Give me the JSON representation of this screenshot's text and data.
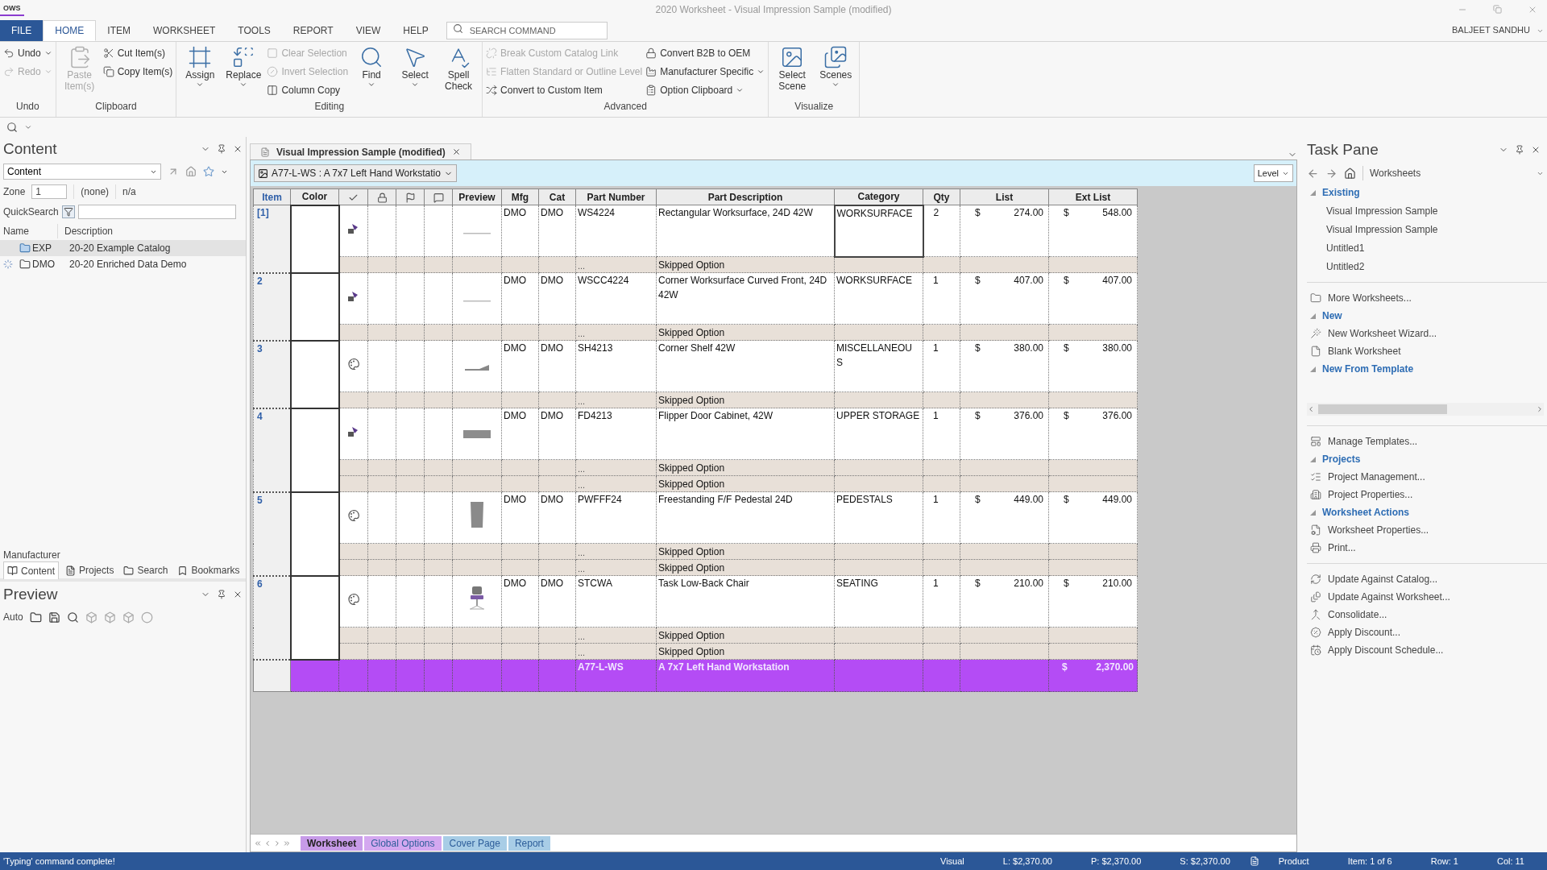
{
  "window": {
    "title": "2020 Worksheet - Visual Impression Sample (modified)",
    "logo": "OWS"
  },
  "ribbon_tabs": [
    {
      "label": "FILE",
      "kind": "file",
      "selected": false
    },
    {
      "label": "HOME",
      "kind": "tab",
      "selected": true
    },
    {
      "label": "ITEM",
      "kind": "tab",
      "selected": false
    },
    {
      "label": "WORKSHEET",
      "kind": "tab",
      "selected": false
    },
    {
      "label": "TOOLS",
      "kind": "tab",
      "selected": false
    },
    {
      "label": "REPORT",
      "kind": "tab",
      "selected": false
    },
    {
      "label": "VIEW",
      "kind": "tab",
      "selected": false
    },
    {
      "label": "HELP",
      "kind": "tab",
      "selected": false
    }
  ],
  "search": {
    "placeholder": "SEARCH COMMAND"
  },
  "user": "BALJEET SANDHU",
  "ribbon": [
    {
      "label": "Undo",
      "columns": [
        {
          "kind": "small",
          "buttons": [
            {
              "label": "Undo",
              "disabled": false,
              "dropdown": true
            },
            {
              "label": "Redo",
              "disabled": true,
              "dropdown": true
            }
          ]
        }
      ]
    },
    {
      "label": "Clipboard",
      "columns": [
        {
          "kind": "large",
          "buttons": [
            {
              "label": "Paste Item(s)",
              "disabled": true,
              "dropdown": false
            }
          ]
        },
        {
          "kind": "small",
          "buttons": [
            {
              "label": "Cut Item(s)",
              "disabled": false,
              "dropdown": false
            },
            {
              "label": "Copy Item(s)",
              "disabled": false,
              "dropdown": false
            }
          ]
        }
      ]
    },
    {
      "label": "Editing",
      "columns": [
        {
          "kind": "large",
          "buttons": [
            {
              "label": "Assign",
              "disabled": false,
              "dropdown": true
            }
          ]
        },
        {
          "kind": "large",
          "buttons": [
            {
              "label": "Replace",
              "disabled": false,
              "dropdown": true
            }
          ]
        },
        {
          "kind": "small",
          "buttons": [
            {
              "label": "Clear Selection",
              "disabled": true,
              "dropdown": false
            },
            {
              "label": "Invert Selection",
              "disabled": true,
              "dropdown": false
            },
            {
              "label": "Column Copy",
              "disabled": false,
              "dropdown": false
            }
          ]
        },
        {
          "kind": "large",
          "buttons": [
            {
              "label": "Find",
              "disabled": false,
              "dropdown": true
            }
          ]
        },
        {
          "kind": "large",
          "buttons": [
            {
              "label": "Select",
              "disabled": false,
              "dropdown": true
            }
          ]
        },
        {
          "kind": "large",
          "buttons": [
            {
              "label": "Spell Check",
              "disabled": false,
              "dropdown": false
            }
          ]
        }
      ]
    },
    {
      "label": "Advanced",
      "columns": [
        {
          "kind": "small",
          "buttons": [
            {
              "label": "Break Custom Catalog Link",
              "disabled": true,
              "dropdown": false
            },
            {
              "label": "Flatten Standard or Outline Level",
              "disabled": true,
              "dropdown": false
            },
            {
              "label": "Convert to Custom Item",
              "disabled": false,
              "dropdown": false
            }
          ]
        },
        {
          "kind": "small",
          "buttons": [
            {
              "label": "Convert B2B to OEM",
              "disabled": false,
              "dropdown": false
            },
            {
              "label": "Manufacturer Specific",
              "disabled": false,
              "dropdown": true
            },
            {
              "label": "Option Clipboard",
              "disabled": false,
              "dropdown": true
            }
          ]
        }
      ]
    },
    {
      "label": "Visualize",
      "columns": [
        {
          "kind": "large",
          "buttons": [
            {
              "label": "Select Scene",
              "disabled": false,
              "dropdown": false
            }
          ]
        },
        {
          "kind": "large",
          "buttons": [
            {
              "label": "Scenes",
              "disabled": false,
              "dropdown": true
            }
          ]
        }
      ]
    }
  ],
  "content_panel": {
    "title": "Content",
    "source": "Content",
    "zone_label": "Zone",
    "zone": "1",
    "zone_name": "(none)",
    "zone_value": "n/a",
    "quicksearch_label": "QuickSearch",
    "columns": [
      "Name",
      "Description"
    ],
    "items": [
      {
        "name": "EXP",
        "description": "20-20 Example Catalog",
        "selected": true,
        "loading": false
      },
      {
        "name": "DMO",
        "description": "20-20 Enriched Data Demo",
        "selected": false,
        "loading": true
      }
    ],
    "footer_label": "Manufacturer",
    "tabs": [
      {
        "label": "Content",
        "selected": true
      },
      {
        "label": "Projects",
        "selected": false
      },
      {
        "label": "Search",
        "selected": false
      },
      {
        "label": "Bookmarks",
        "selected": false
      }
    ]
  },
  "preview_panel": {
    "title": "Preview",
    "mode": "Auto"
  },
  "document": {
    "tab": "Visual Impression Sample (modified)",
    "selector": "A77-L-WS : A 7x7 Left Hand Workstatio",
    "level": "Level"
  },
  "table": {
    "columns": [
      "Item",
      "Color",
      "",
      "",
      "",
      "",
      "Preview",
      "Mfg",
      "Cat",
      "Part Number",
      "Part Description",
      "Category",
      "Qty",
      "List",
      "Ext List"
    ],
    "rows": [
      {
        "item": "[1]",
        "kind": "component",
        "preview": {
          "kind": "line"
        },
        "mfg": "DMO",
        "cat": "DMO",
        "part": "WS4224",
        "description": "Rectangular Worksurface, 24D 42W",
        "category": "WORKSURFACE",
        "qty": "2",
        "list": {
          "currency": "$",
          "amount": "274.00"
        },
        "ext": {
          "currency": "$",
          "amount": "548.00"
        },
        "selected": true,
        "options": [
          {
            "part": "...",
            "description": "Skipped Option"
          }
        ]
      },
      {
        "item": "2",
        "kind": "component",
        "preview": {
          "kind": "line"
        },
        "mfg": "DMO",
        "cat": "DMO",
        "part": "WSCC4224",
        "description": "Corner Worksurface Curved Front, 24D 42W",
        "category": "WORKSURFACE",
        "qty": "1",
        "list": {
          "currency": "$",
          "amount": "407.00"
        },
        "ext": {
          "currency": "$",
          "amount": "407.00"
        },
        "selected": false,
        "options": [
          {
            "part": "...",
            "description": "Skipped Option"
          }
        ]
      },
      {
        "item": "3",
        "kind": "finish",
        "preview": {
          "kind": "shelf"
        },
        "mfg": "DMO",
        "cat": "DMO",
        "part": "SH4213",
        "description": "Corner Shelf 42W",
        "category": "MISCELLANEOU S",
        "qty": "1",
        "list": {
          "currency": "$",
          "amount": "380.00"
        },
        "ext": {
          "currency": "$",
          "amount": "380.00"
        },
        "selected": false,
        "options": [
          {
            "part": "...",
            "description": "Skipped Option"
          }
        ]
      },
      {
        "item": "4",
        "kind": "component",
        "preview": {
          "kind": "panel"
        },
        "mfg": "DMO",
        "cat": "DMO",
        "part": "FD4213",
        "description": "Flipper Door Cabinet, 42W",
        "category": "UPPER STORAGE",
        "qty": "1",
        "list": {
          "currency": "$",
          "amount": "376.00"
        },
        "ext": {
          "currency": "$",
          "amount": "376.00"
        },
        "selected": false,
        "options": [
          {
            "part": "...",
            "description": "Skipped Option"
          },
          {
            "part": "...",
            "description": "Skipped Option"
          }
        ]
      },
      {
        "item": "5",
        "kind": "finish",
        "preview": {
          "kind": "pedestal"
        },
        "mfg": "DMO",
        "cat": "DMO",
        "part": "PWFFF24",
        "description": "Freestanding F/F Pedestal 24D",
        "category": "PEDESTALS",
        "qty": "1",
        "list": {
          "currency": "$",
          "amount": "449.00"
        },
        "ext": {
          "currency": "$",
          "amount": "449.00"
        },
        "selected": false,
        "options": [
          {
            "part": "...",
            "description": "Skipped Option"
          },
          {
            "part": "...",
            "description": "Skipped Option"
          }
        ]
      },
      {
        "item": "6",
        "kind": "finish",
        "preview": {
          "kind": "chair"
        },
        "mfg": "DMO",
        "cat": "DMO",
        "part": "STCWA",
        "description": "Task Low-Back Chair",
        "category": "SEATING",
        "qty": "1",
        "list": {
          "currency": "$",
          "amount": "210.00"
        },
        "ext": {
          "currency": "$",
          "amount": "210.00"
        },
        "selected": false,
        "options": [
          {
            "part": "...",
            "description": "Skipped Option"
          },
          {
            "part": "...",
            "description": "Skipped Option"
          }
        ]
      }
    ],
    "total": {
      "part": "A77-L-WS",
      "description": "A 7x7 Left Hand Workstation",
      "currency": "$",
      "amount": "2,370.00",
      "color": "#b44cf5"
    }
  },
  "sheet_tabs": [
    {
      "label": "Worksheet",
      "selected": true,
      "color": "#c79be8"
    },
    {
      "label": "Global Options",
      "selected": false,
      "color": "#d4a8f0"
    },
    {
      "label": "Cover Page",
      "selected": false,
      "color": "#a8cde6"
    },
    {
      "label": "Report",
      "selected": false,
      "color": "#a8cde6"
    }
  ],
  "task_pane": {
    "title": "Task Pane",
    "location": "Worksheets",
    "sections": [
      {
        "has_scrollbar": false,
        "entries": [
          {
            "kind": "heading",
            "label": "Existing",
            "expanded": true
          },
          {
            "kind": "entry",
            "label": "Visual Impression Sample"
          },
          {
            "kind": "entry",
            "label": "Visual Impression Sample"
          },
          {
            "kind": "entry",
            "label": "Untitled1"
          },
          {
            "kind": "entry",
            "label": "Untitled2"
          }
        ]
      },
      {
        "has_scrollbar": true,
        "entries": [
          {
            "kind": "action",
            "label": "More Worksheets..."
          },
          {
            "kind": "heading",
            "label": "New",
            "expanded": true
          },
          {
            "kind": "action",
            "label": "New Worksheet Wizard..."
          },
          {
            "kind": "action",
            "label": "Blank Worksheet"
          },
          {
            "kind": "heading",
            "label": "New From Template",
            "expanded": true
          }
        ]
      },
      {
        "has_scrollbar": false,
        "entries": [
          {
            "kind": "action",
            "label": "Manage Templates..."
          },
          {
            "kind": "heading",
            "label": "Projects",
            "expanded": true
          },
          {
            "kind": "action",
            "label": "Project Management..."
          },
          {
            "kind": "action",
            "label": "Project Properties..."
          },
          {
            "kind": "heading",
            "label": "Worksheet Actions",
            "expanded": true
          },
          {
            "kind": "action",
            "label": "Worksheet Properties..."
          },
          {
            "kind": "action",
            "label": "Print..."
          }
        ]
      },
      {
        "has_scrollbar": false,
        "entries": [
          {
            "kind": "action",
            "label": "Update Against Catalog..."
          },
          {
            "kind": "action",
            "label": "Update Against Worksheet..."
          },
          {
            "kind": "action",
            "label": "Consolidate..."
          },
          {
            "kind": "action",
            "label": "Apply Discount..."
          },
          {
            "kind": "action",
            "label": "Apply Discount Schedule..."
          }
        ]
      }
    ]
  },
  "status_bar": {
    "message": "'Typing' command complete!",
    "fields": [
      "Visual",
      "L: $2,370.00",
      "P: $2,370.00",
      "S: $2,370.00",
      "Product",
      "Item: 1 of 6",
      "Row: 1",
      "Col: 11"
    ]
  }
}
